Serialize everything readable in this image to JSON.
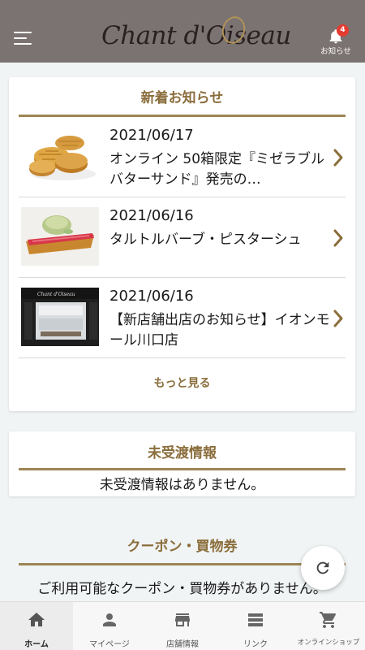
{
  "header": {
    "logo_text": "Chant d'Oiseau",
    "notification": {
      "count": "4",
      "label": "お知らせ"
    }
  },
  "news": {
    "title": "新着お知らせ",
    "items": [
      {
        "date": "2021/06/17",
        "text": "オンライン 50箱限定『ミゼラブルバターサンド』発売の…"
      },
      {
        "date": "2021/06/16",
        "text": "タルトルバーブ・ピスターシュ"
      },
      {
        "date": "2021/06/16",
        "text": "【新店舗出店のお知らせ】イオンモール川口店"
      }
    ],
    "more_label": "もっと見る"
  },
  "undelivered": {
    "title": "未受渡情報",
    "message": "未受渡情報はありません。"
  },
  "coupon": {
    "title": "クーポン・買物券",
    "message": "ご利用可能なクーポン・買物券がありません。"
  },
  "tabs": [
    {
      "label": "ホーム",
      "icon": "home-icon",
      "active": true
    },
    {
      "label": "マイページ",
      "icon": "person-icon",
      "active": false
    },
    {
      "label": "店舗情報",
      "icon": "store-icon",
      "active": false
    },
    {
      "label": "リンク",
      "icon": "list-icon",
      "active": false
    },
    {
      "label": "オンラインショップ",
      "icon": "cart-icon",
      "active": false
    }
  ],
  "colors": {
    "header_bg": "#7b7372",
    "accent_gold": "#8a6d3b",
    "badge_red": "#e53a2f"
  }
}
